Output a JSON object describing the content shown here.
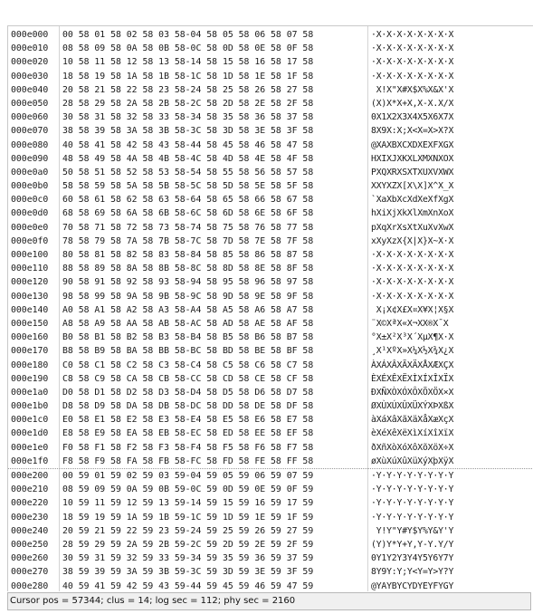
{
  "status": "Cursor pos = 57344; clus = 14; log sec = 112; phy sec = 2160",
  "rows": [
    {
      "addr": "000e000",
      "hex": "00 58 01 58 02 58 03 58-04 58 05 58 06 58 07 58",
      "ascii": "·X·X·X·X·X·X·X·X"
    },
    {
      "addr": "000e010",
      "hex": "08 58 09 58 0A 58 0B 58-0C 58 0D 58 0E 58 0F 58",
      "ascii": "·X·X·X·X·X·X·X·X"
    },
    {
      "addr": "000e020",
      "hex": "10 58 11 58 12 58 13 58-14 58 15 58 16 58 17 58",
      "ascii": "·X·X·X·X·X·X·X·X"
    },
    {
      "addr": "000e030",
      "hex": "18 58 19 58 1A 58 1B 58-1C 58 1D 58 1E 58 1F 58",
      "ascii": "·X·X·X·X·X·X·X·X"
    },
    {
      "addr": "000e040",
      "hex": "20 58 21 58 22 58 23 58-24 58 25 58 26 58 27 58",
      "ascii": " X!X\"X#X$X%X&X'X"
    },
    {
      "addr": "000e050",
      "hex": "28 58 29 58 2A 58 2B 58-2C 58 2D 58 2E 58 2F 58",
      "ascii": "(X)X*X+X,X-X.X/X"
    },
    {
      "addr": "000e060",
      "hex": "30 58 31 58 32 58 33 58-34 58 35 58 36 58 37 58",
      "ascii": "0X1X2X3X4X5X6X7X"
    },
    {
      "addr": "000e070",
      "hex": "38 58 39 58 3A 58 3B 58-3C 58 3D 58 3E 58 3F 58",
      "ascii": "8X9X:X;X<X=X>X?X"
    },
    {
      "addr": "000e080",
      "hex": "40 58 41 58 42 58 43 58-44 58 45 58 46 58 47 58",
      "ascii": "@XAXBXCXDXEXFXGX"
    },
    {
      "addr": "000e090",
      "hex": "48 58 49 58 4A 58 4B 58-4C 58 4D 58 4E 58 4F 58",
      "ascii": "HXIXJXKXLXMXNXOX"
    },
    {
      "addr": "000e0a0",
      "hex": "50 58 51 58 52 58 53 58-54 58 55 58 56 58 57 58",
      "ascii": "PXQXRXSXTXUXVXWX"
    },
    {
      "addr": "000e0b0",
      "hex": "58 58 59 58 5A 58 5B 58-5C 58 5D 58 5E 58 5F 58",
      "ascii": "XXYXZX[X\\X]X^X_X"
    },
    {
      "addr": "000e0c0",
      "hex": "60 58 61 58 62 58 63 58-64 58 65 58 66 58 67 58",
      "ascii": "`XaXbXcXdXeXfXgX"
    },
    {
      "addr": "000e0d0",
      "hex": "68 58 69 58 6A 58 6B 58-6C 58 6D 58 6E 58 6F 58",
      "ascii": "hXiXjXkXlXmXnXoX"
    },
    {
      "addr": "000e0e0",
      "hex": "70 58 71 58 72 58 73 58-74 58 75 58 76 58 77 58",
      "ascii": "pXqXrXsXtXuXvXwX"
    },
    {
      "addr": "000e0f0",
      "hex": "78 58 79 58 7A 58 7B 58-7C 58 7D 58 7E 58 7F 58",
      "ascii": "xXyXzX{X|X}X~X·X"
    },
    {
      "addr": "000e100",
      "hex": "80 58 81 58 82 58 83 58-84 58 85 58 86 58 87 58",
      "ascii": "·X·X·X·X·X·X·X·X"
    },
    {
      "addr": "000e110",
      "hex": "88 58 89 58 8A 58 8B 58-8C 58 8D 58 8E 58 8F 58",
      "ascii": "·X·X·X·X·X·X·X·X"
    },
    {
      "addr": "000e120",
      "hex": "90 58 91 58 92 58 93 58-94 58 95 58 96 58 97 58",
      "ascii": "·X·X·X·X·X·X·X·X"
    },
    {
      "addr": "000e130",
      "hex": "98 58 99 58 9A 58 9B 58-9C 58 9D 58 9E 58 9F 58",
      "ascii": "·X·X·X·X·X·X·X·X"
    },
    {
      "addr": "000e140",
      "hex": "A0 58 A1 58 A2 58 A3 58-A4 58 A5 58 A6 58 A7 58",
      "ascii": " X¡X¢X£X¤X¥X¦X§X"
    },
    {
      "addr": "000e150",
      "hex": "A8 58 A9 58 AA 58 AB 58-AC 58 AD 58 AE 58 AF 58",
      "ascii": "¨X©XªX«X¬X­X®X¯X"
    },
    {
      "addr": "000e160",
      "hex": "B0 58 B1 58 B2 58 B3 58-B4 58 B5 58 B6 58 B7 58",
      "ascii": "°X±X²X³X´XµX¶X·X"
    },
    {
      "addr": "000e170",
      "hex": "B8 58 B9 58 BA 58 BB 58-BC 58 BD 58 BE 58 BF 58",
      "ascii": "¸X¹XºX»X¼X½X¾X¿X"
    },
    {
      "addr": "000e180",
      "hex": "C0 58 C1 58 C2 58 C3 58-C4 58 C5 58 C6 58 C7 58",
      "ascii": "ÀXÁXÂXÃXÄXÅXÆXÇX"
    },
    {
      "addr": "000e190",
      "hex": "C8 58 C9 58 CA 58 CB 58-CC 58 CD 58 CE 58 CF 58",
      "ascii": "ÈXÉXÊXËXÌXÍXÎXÏX"
    },
    {
      "addr": "000e1a0",
      "hex": "D0 58 D1 58 D2 58 D3 58-D4 58 D5 58 D6 58 D7 58",
      "ascii": "ÐXÑXÒXÓXÔXÕXÖX×X"
    },
    {
      "addr": "000e1b0",
      "hex": "D8 58 D9 58 DA 58 DB 58-DC 58 DD 58 DE 58 DF 58",
      "ascii": "ØXÙXÚXÛXÜXÝXÞXßX"
    },
    {
      "addr": "000e1c0",
      "hex": "E0 58 E1 58 E2 58 E3 58-E4 58 E5 58 E6 58 E7 58",
      "ascii": "àXáXâXãXäXåXæXçX"
    },
    {
      "addr": "000e1d0",
      "hex": "E8 58 E9 58 EA 58 EB 58-EC 58 ED 58 EE 58 EF 58",
      "ascii": "èXéXêXëXìXíXîXïX"
    },
    {
      "addr": "000e1e0",
      "hex": "F0 58 F1 58 F2 58 F3 58-F4 58 F5 58 F6 58 F7 58",
      "ascii": "ðXñXòXóXôXõXöX÷X"
    },
    {
      "addr": "000e1f0",
      "hex": "F8 58 F9 58 FA 58 FB 58-FC 58 FD 58 FE 58 FF 58",
      "ascii": "øXùXúXûXüXýXþXÿX"
    },
    {
      "addr": "000e200",
      "hex": "00 59 01 59 02 59 03 59-04 59 05 59 06 59 07 59",
      "ascii": "·Y·Y·Y·Y·Y·Y·Y·Y"
    },
    {
      "addr": "000e210",
      "hex": "08 59 09 59 0A 59 0B 59-0C 59 0D 59 0E 59 0F 59",
      "ascii": "·Y·Y·Y·Y·Y·Y·Y·Y"
    },
    {
      "addr": "000e220",
      "hex": "10 59 11 59 12 59 13 59-14 59 15 59 16 59 17 59",
      "ascii": "·Y·Y·Y·Y·Y·Y·Y·Y"
    },
    {
      "addr": "000e230",
      "hex": "18 59 19 59 1A 59 1B 59-1C 59 1D 59 1E 59 1F 59",
      "ascii": "·Y·Y·Y·Y·Y·Y·Y·Y"
    },
    {
      "addr": "000e240",
      "hex": "20 59 21 59 22 59 23 59-24 59 25 59 26 59 27 59",
      "ascii": " Y!Y\"Y#Y$Y%Y&Y'Y"
    },
    {
      "addr": "000e250",
      "hex": "28 59 29 59 2A 59 2B 59-2C 59 2D 59 2E 59 2F 59",
      "ascii": "(Y)Y*Y+Y,Y-Y.Y/Y"
    },
    {
      "addr": "000e260",
      "hex": "30 59 31 59 32 59 33 59-34 59 35 59 36 59 37 59",
      "ascii": "0Y1Y2Y3Y4Y5Y6Y7Y"
    },
    {
      "addr": "000e270",
      "hex": "38 59 39 59 3A 59 3B 59-3C 59 3D 59 3E 59 3F 59",
      "ascii": "8Y9Y:Y;Y<Y=Y>Y?Y"
    },
    {
      "addr": "000e280",
      "hex": "40 59 41 59 42 59 43 59-44 59 45 59 46 59 47 59",
      "ascii": "@YAYBYCYDYEYFYGY"
    }
  ]
}
